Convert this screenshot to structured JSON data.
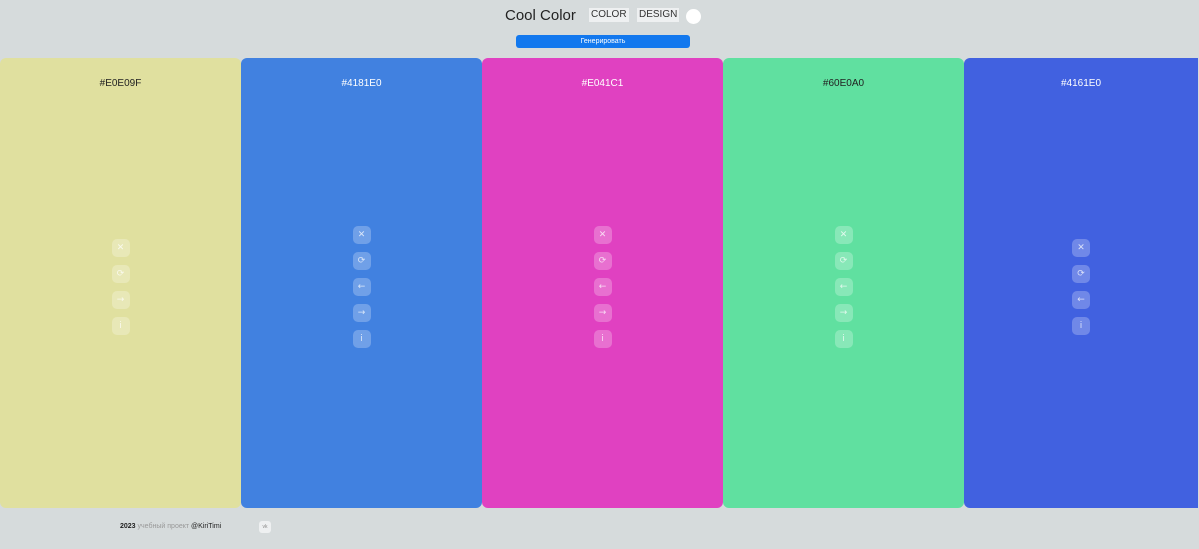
{
  "header": {
    "brand": "Cool Color",
    "nav": {
      "color": "COLOR",
      "design": "DESIGN"
    },
    "generate_label": "Генерировать"
  },
  "palette": [
    {
      "hex": "#E0E09F",
      "text_color": "#222222",
      "tools": [
        "close-icon",
        "refresh-icon",
        "arrow-right-icon",
        "info-icon"
      ]
    },
    {
      "hex": "#4181E0",
      "text_color": "#ffffff",
      "tools": [
        "close-icon",
        "refresh-icon",
        "arrow-left-icon",
        "arrow-right-icon",
        "info-icon"
      ]
    },
    {
      "hex": "#E041C1",
      "text_color": "#ffffff",
      "tools": [
        "close-icon",
        "refresh-icon",
        "arrow-left-icon",
        "arrow-right-icon",
        "info-icon"
      ]
    },
    {
      "hex": "#60E0A0",
      "text_color": "#222222",
      "tools": [
        "close-icon",
        "refresh-icon",
        "arrow-left-icon",
        "arrow-right-icon",
        "info-icon"
      ]
    },
    {
      "hex": "#4161E0",
      "text_color": "#ffffff",
      "tools": [
        "close-icon",
        "refresh-icon",
        "arrow-left-icon",
        "info-icon"
      ]
    }
  ],
  "icon_glyphs": {
    "close-icon": "✕",
    "refresh-icon": "⟳",
    "arrow-left-icon": "←",
    "arrow-right-icon": "→",
    "info-icon": "i"
  },
  "footer": {
    "year": "2023",
    "text": "учебный проект",
    "author": "@KiriTimi",
    "social": "vk"
  }
}
